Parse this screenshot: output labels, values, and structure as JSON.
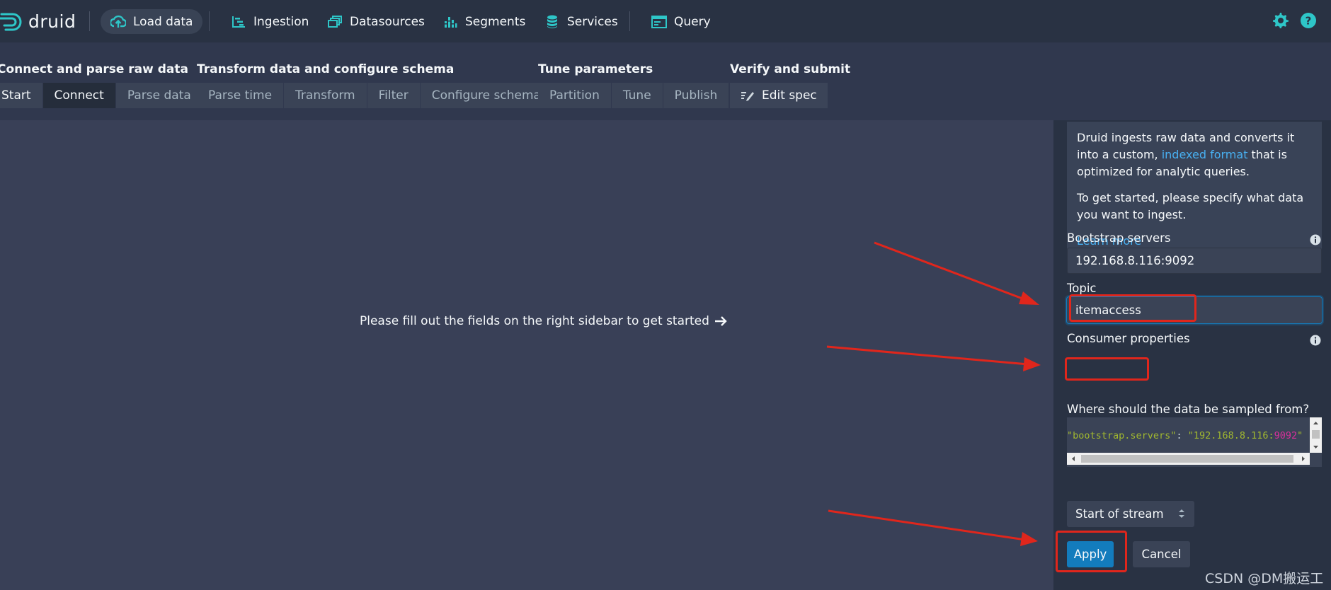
{
  "app": {
    "name": "druid"
  },
  "nav": {
    "items": [
      {
        "label": "Load data",
        "icon": "cloud-upload-icon"
      },
      {
        "label": "Ingestion",
        "icon": "gantt-chart-icon"
      },
      {
        "label": "Datasources",
        "icon": "multi-select-icon"
      },
      {
        "label": "Segments",
        "icon": "stacked-chart-icon"
      },
      {
        "label": "Services",
        "icon": "database-icon"
      },
      {
        "label": "Query",
        "icon": "application-icon"
      }
    ],
    "right_icons": [
      "gear-icon",
      "help-icon"
    ],
    "accent_color": "#2ec6c8"
  },
  "steps": {
    "groups": [
      {
        "title": "Connect and parse raw data",
        "buttons": [
          "Start",
          "Connect",
          "Parse data"
        ]
      },
      {
        "title": "Transform data and configure schema",
        "buttons": [
          "Parse time",
          "Transform",
          "Filter",
          "Configure schema"
        ]
      },
      {
        "title": "Tune parameters",
        "buttons": [
          "Partition",
          "Tune",
          "Publish"
        ]
      },
      {
        "title": "Verify and submit",
        "buttons": [
          "Edit spec"
        ]
      }
    ],
    "current": "Connect"
  },
  "main": {
    "message": "Please fill out the fields on the right sidebar to get started"
  },
  "sidebar": {
    "info": {
      "p1_before": "Druid ingests raw data and converts it into a custom, ",
      "p1_link": "indexed format",
      "p1_after": " that is optimized for analytic queries.",
      "p2": "To get started, please specify what data you want to ingest.",
      "learn_more": "Learn more"
    },
    "bootstrap": {
      "label": "Bootstrap servers",
      "value": "192.168.8.116:9092"
    },
    "topic": {
      "label": "Topic",
      "value": "itemaccess"
    },
    "consumer": {
      "label": "Consumer properties",
      "key": "\"bootstrap.servers\"",
      "colon": ": ",
      "value_prefix": "\"192.168.8.116:",
      "value_num": "9092",
      "value_suffix": "\""
    },
    "sample": {
      "label": "Where should the data be sampled from?",
      "selected": "Start of stream"
    },
    "apply_label": "Apply",
    "cancel_label": "Cancel"
  },
  "annotation_color": "#e0261c",
  "watermark": "CSDN @DM搬运工"
}
